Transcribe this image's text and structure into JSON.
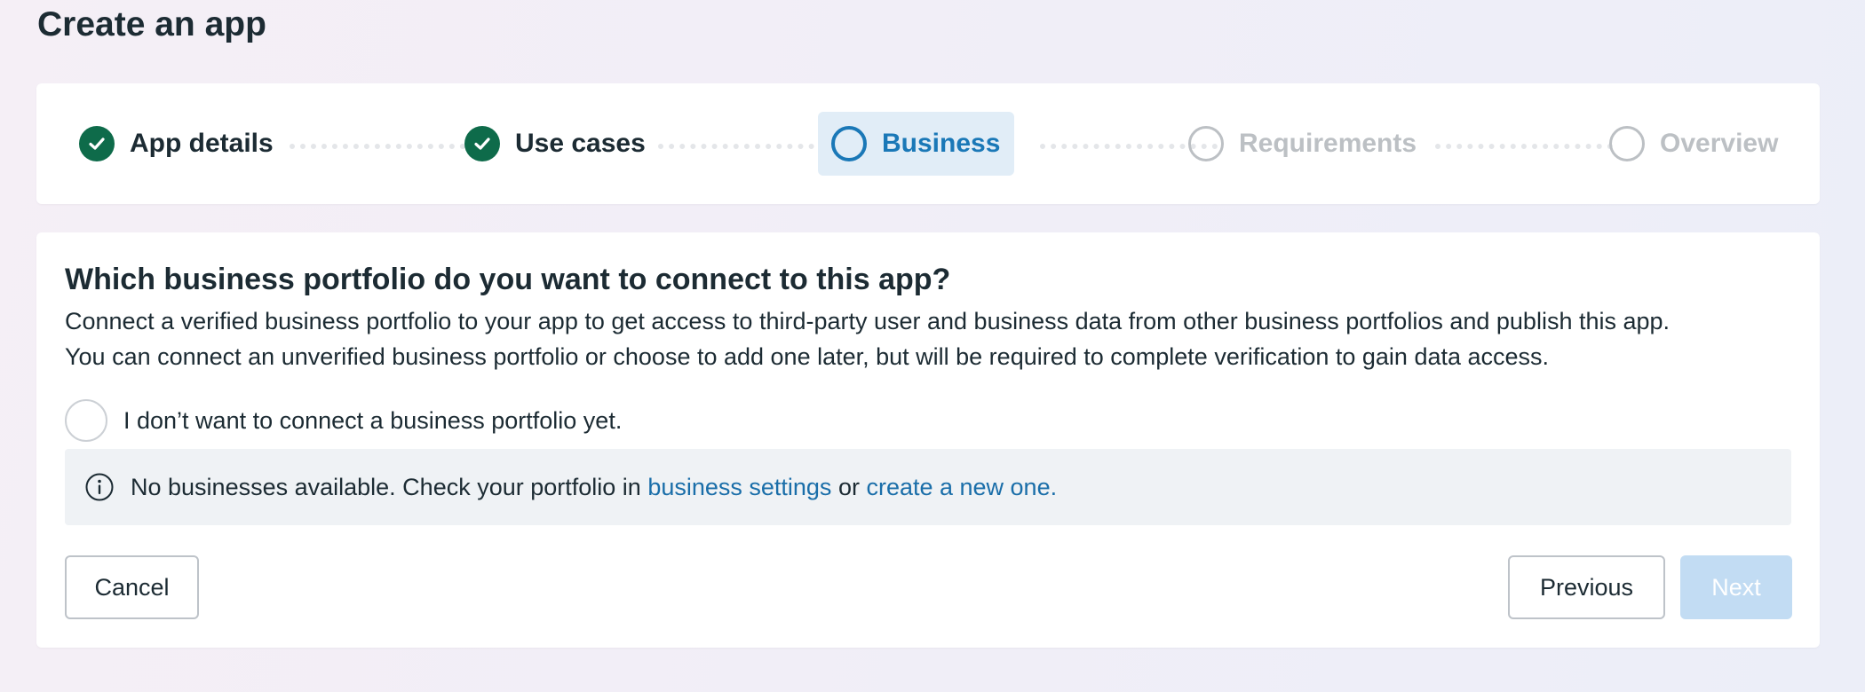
{
  "page": {
    "title": "Create an app"
  },
  "stepper": {
    "steps": [
      {
        "label": "App details",
        "state": "completed",
        "icon": "check-icon"
      },
      {
        "label": "Use cases",
        "state": "completed",
        "icon": "check-icon"
      },
      {
        "label": "Business",
        "state": "current",
        "icon": "circle-icon"
      },
      {
        "label": "Requirements",
        "state": "upcoming",
        "icon": "circle-icon"
      },
      {
        "label": "Overview",
        "state": "upcoming",
        "icon": "circle-icon"
      }
    ]
  },
  "content": {
    "question": "Which business portfolio do you want to connect to this app?",
    "description_line1": "Connect a verified business portfolio to your app to get access to third-party user and business data from other business portfolios and publish this app.",
    "description_line2": "You can connect an unverified business portfolio or choose to add one later, but will be required to complete verification to gain data access.",
    "radio_option": {
      "label": "I don’t want to connect a business portfolio yet.",
      "checked": false
    }
  },
  "info_banner": {
    "icon": "info-icon",
    "text_before": "No businesses available. Check your portfolio in ",
    "link1": "business settings",
    "text_middle": " or ",
    "link2": "create a new one."
  },
  "buttons": {
    "cancel": "Cancel",
    "previous": "Previous",
    "next": "Next",
    "next_disabled": true
  },
  "colors": {
    "completed": "#0e6b4a",
    "current": "#1a78b7",
    "current_bg": "#e1edf7",
    "upcoming": "#bcc0c4",
    "link": "#1a6ea9",
    "next_disabled_bg": "#c2dcf3"
  }
}
